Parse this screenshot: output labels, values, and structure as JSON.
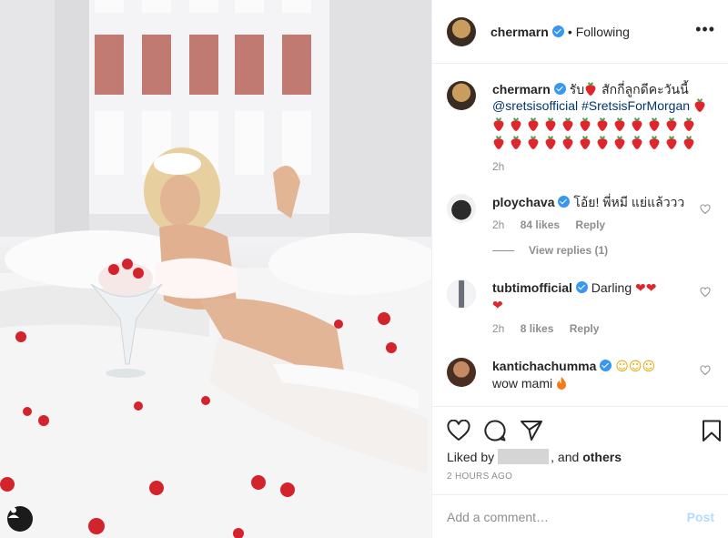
{
  "post": {
    "author": "chermarn",
    "follow_status": "Following",
    "dot": "•",
    "more_icon": "•••",
    "caption": {
      "text_start": "รับ",
      "text_after": "สักกี่ลูกดีคะวันนี้",
      "mention": "@sretsisofficial",
      "hashtag": "#SretsisForMorgan",
      "strawberry_icon": "strawberry-icon",
      "time": "2h"
    },
    "comments": [
      {
        "username": "ploychava",
        "text": "โอ้ย! พี่หมี แย่แล้ววว",
        "time": "2h",
        "likes": "84 likes",
        "reply": "Reply",
        "view_replies": "View replies (1)"
      },
      {
        "username": "tubtimofficial",
        "text": "Darling",
        "heart_icons": "heart-emoji",
        "time": "2h",
        "likes": "8 likes",
        "reply": "Reply"
      },
      {
        "username": "kantichachumma",
        "text": "wow mami",
        "emoji_icons": "smiling-face-emoji",
        "extra_icon": "fire-emoji"
      }
    ],
    "liked_by": {
      "prefix": "Liked by",
      "suffix": ", and",
      "others": "others"
    },
    "timestamp": "2 HOURS AGO",
    "add_comment": {
      "placeholder": "Add a comment…",
      "post_label": "Post"
    }
  },
  "colors": {
    "verified": "#3897f0",
    "link": "#00376b",
    "muted": "#8e8e8e",
    "post_disabled": "#b3dbff",
    "strawberry": "#e0262d"
  }
}
